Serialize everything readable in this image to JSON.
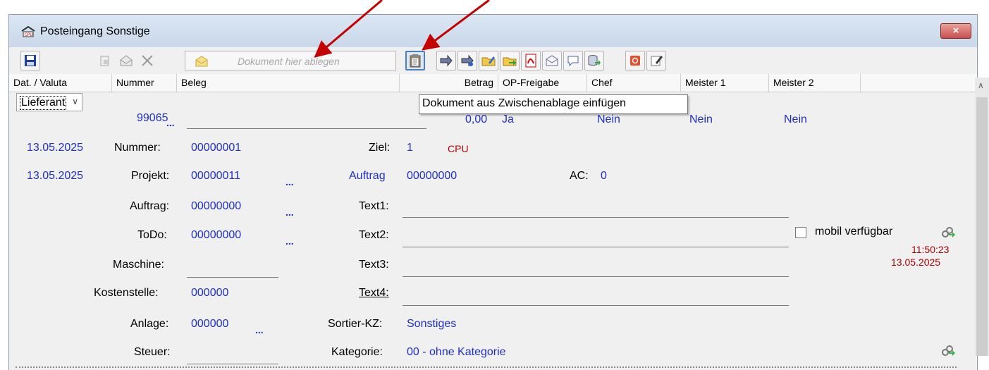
{
  "window": {
    "title": "Posteingang Sonstige",
    "close_label": "×"
  },
  "toolbar": {
    "dropzone_text": "Dokument hier ablegen",
    "icons": [
      "save-icon",
      "copy-icon",
      "envelope-icon",
      "delete-icon",
      "dropzone-icon",
      "paste-clipboard-icon",
      "forward-icon",
      "scan-icon",
      "folder-edit-icon",
      "folder-open-icon",
      "pdf-icon",
      "mail-icon",
      "comment-icon",
      "database-export-icon",
      "app-red-icon",
      "edit-icon"
    ]
  },
  "columns": [
    "Dat. / Valuta",
    "Nummer",
    "Beleg",
    "Betrag",
    "OP-Freigabe",
    "Chef",
    "Meister 1",
    "Meister 2"
  ],
  "row": {
    "type_select": "Lieferant",
    "nummer": "99065",
    "dots": "...",
    "betrag": "0,00",
    "op_freigabe": "Ja",
    "chef": "Nein",
    "meister1": "Nein",
    "meister2": "Nein"
  },
  "tooltip": "Dokument aus Zwischenablage einfügen",
  "details": {
    "date1": "13.05.2025",
    "date2": "13.05.2025",
    "nummer_label": "Nummer:",
    "nummer_value": "00000001",
    "projekt_label": "Projekt:",
    "projekt_value": "00000011",
    "auftrag_label": "Auftrag:",
    "auftrag_value": "00000000",
    "todo_label": "ToDo:",
    "todo_value": "00000000",
    "maschine_label": "Maschine:",
    "kostenstelle_label": "Kostenstelle:",
    "kostenstelle_value": "000000",
    "anlage_label": "Anlage:",
    "anlage_value": "000000",
    "steuer_label": "Steuer:",
    "ziel_label": "Ziel:",
    "ziel_value": "1",
    "cpu_tag": "CPU",
    "auftrag2_label": "Auftrag",
    "auftrag2_value": "00000000",
    "ac_label": "AC:",
    "ac_value": "0",
    "text1_label": "Text1:",
    "text2_label": "Text2:",
    "text3_label": "Text3:",
    "text4_label": "Text4:",
    "sortier_label": "Sortier-KZ:",
    "sortier_value": "Sonstiges",
    "kategorie_label": "Kategorie:",
    "kategorie_value": "00 - ohne Kategorie",
    "mobil_label": "mobil verfügbar",
    "time": "11:50:23",
    "date3": "13.05.2025"
  }
}
